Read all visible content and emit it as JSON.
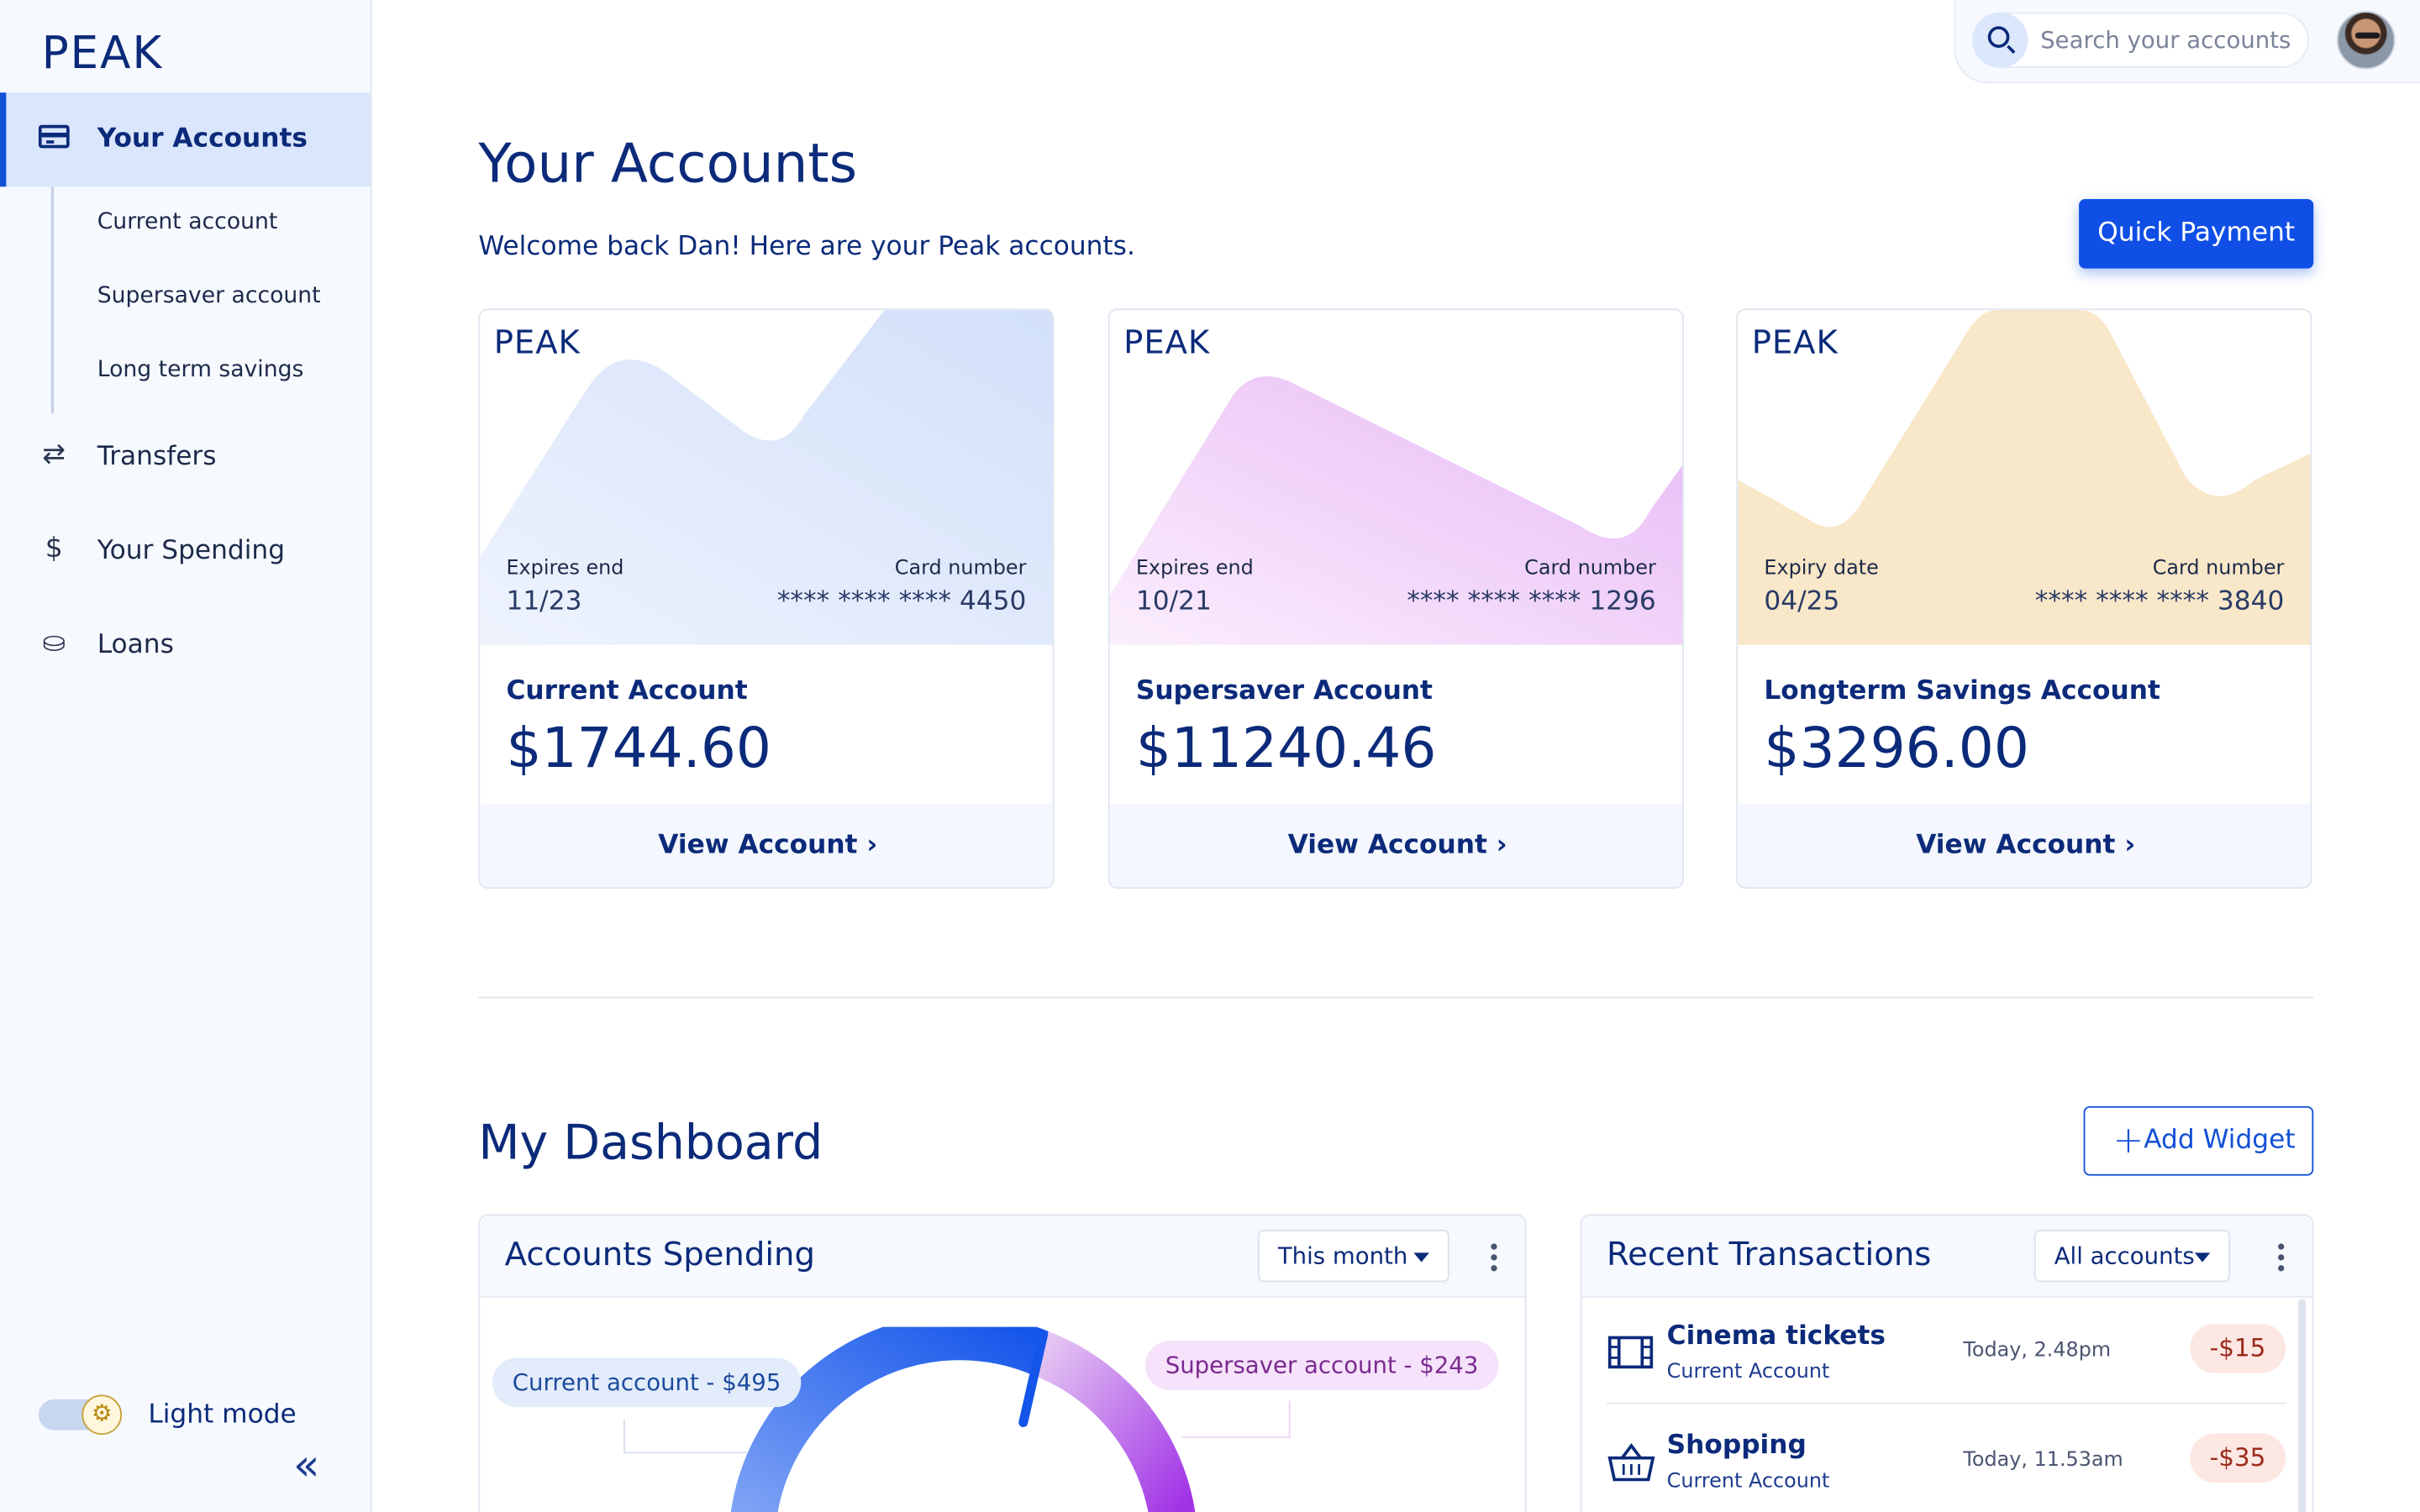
{
  "app": {
    "brand": "PEAK"
  },
  "sidebar": {
    "active": {
      "label": "Your Accounts",
      "icon": "credit-card-icon"
    },
    "sub_items": [
      "Current account",
      "Supersaver account",
      "Long term savings"
    ],
    "items": [
      {
        "label": "Transfers",
        "icon": "transfer-arrows-icon",
        "glyph": "⇄"
      },
      {
        "label": "Your Spending",
        "icon": "dollar-icon",
        "glyph": "$"
      },
      {
        "label": "Loans",
        "icon": "hand-coin-icon",
        "glyph": "⛀"
      }
    ],
    "mode_label": "Light mode",
    "mode_icon": "gear-icon",
    "collapse_icon": "double-chevron-left-icon"
  },
  "header": {
    "search_placeholder": "Search your accounts",
    "search_icon": "search-icon",
    "avatar": "user-avatar"
  },
  "accounts": {
    "title": "Your Accounts",
    "welcome": "Welcome back Dan! Here are your Peak accounts.",
    "quick_payment": "Quick Payment",
    "cards": [
      {
        "brand": "PEAK",
        "expiry_label": "Expires end",
        "expiry": "11/23",
        "number_label": "Card number",
        "number": "**** **** **** 4450",
        "name": "Current Account",
        "balance": "$1744.60",
        "view": "View Account",
        "color": "#d7e3fb"
      },
      {
        "brand": "PEAK",
        "expiry_label": "Expires end",
        "expiry": "10/21",
        "number_label": "Card number",
        "number": "**** **** **** 1296",
        "name": "Supersaver Account",
        "balance": "$11240.46",
        "view": "View Account",
        "color": "#eec6f7"
      },
      {
        "brand": "PEAK",
        "expiry_label": "Expiry date",
        "expiry": "04/25",
        "number_label": "Card number",
        "number": "**** **** **** 3840",
        "name": "Longterm Savings Account",
        "balance": "$3296.00",
        "view": "View Account",
        "color": "#f8e6c6"
      }
    ]
  },
  "dashboard": {
    "title": "My Dashboard",
    "add_widget": "Add Widget",
    "spending": {
      "title": "Accounts Spending",
      "period": "This month",
      "labels": [
        "Current account - $495",
        "Supersaver account - $243"
      ]
    },
    "transactions": {
      "title": "Recent Transactions",
      "filter": "All accounts",
      "items": [
        {
          "title": "Cinema tickets",
          "account": "Current Account",
          "time": "Today, 2.48pm",
          "amount": "-$15",
          "icon": "film-icon"
        },
        {
          "title": "Shopping",
          "account": "Current Account",
          "time": "Today, 11.53am",
          "amount": "-$35",
          "icon": "basket-icon"
        }
      ]
    }
  }
}
